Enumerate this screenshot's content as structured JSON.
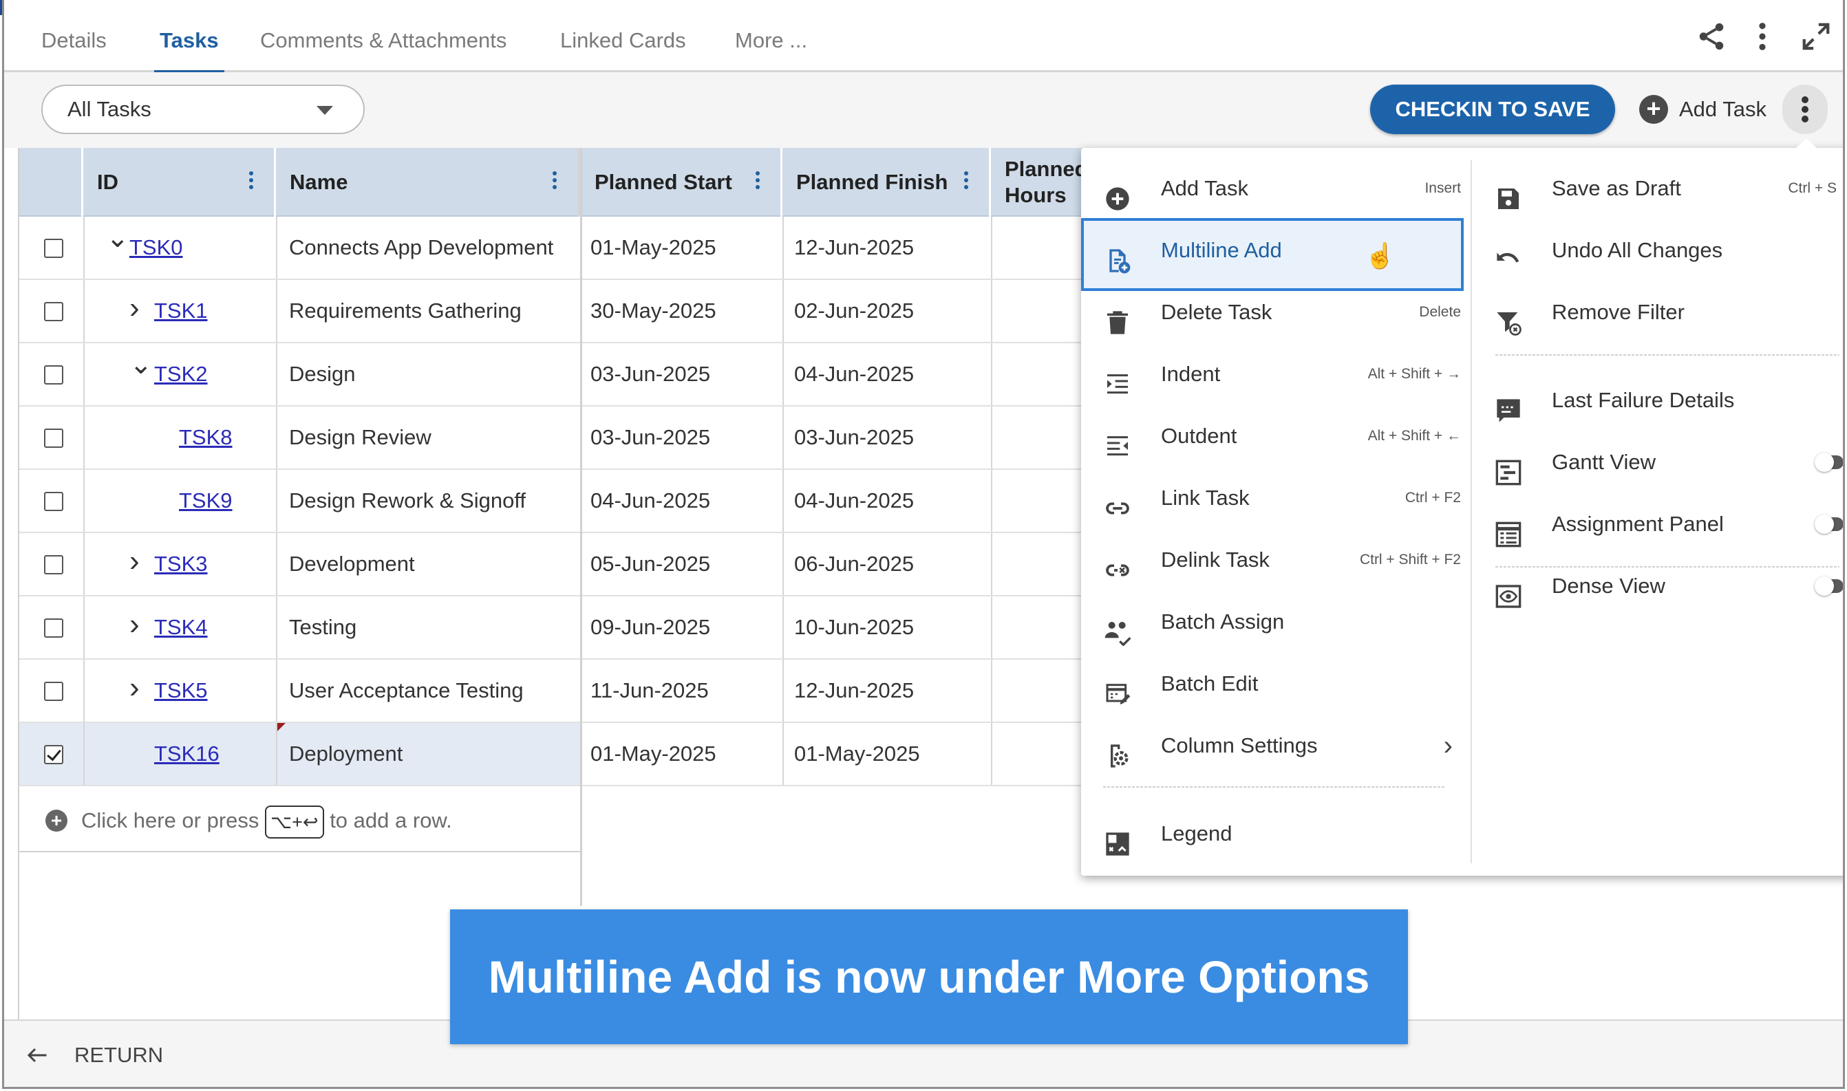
{
  "tabs": [
    "Details",
    "Tasks",
    "Comments & Attachments",
    "Linked Cards",
    "More ..."
  ],
  "active_tab": "Tasks",
  "header_icons": [
    "share-icon",
    "more-vertical-icon",
    "expand-icon"
  ],
  "toolbar": {
    "filter_select": "All Tasks",
    "checkin_button": "CHECKIN TO SAVE",
    "add_task_button": "Add Task"
  },
  "grid": {
    "columns": [
      "ID",
      "Name",
      "Planned Start",
      "Planned Finish",
      "Planned Hours"
    ],
    "rows": [
      {
        "id": "TSK0",
        "name": "Connects App Development",
        "start": "01-May-2025",
        "finish": "12-Jun-2025",
        "expander": "expanded",
        "checked": false
      },
      {
        "id": "TSK1",
        "name": "Requirements Gathering",
        "start": "30-May-2025",
        "finish": "02-Jun-2025",
        "expander": "collapsed",
        "checked": false
      },
      {
        "id": "TSK2",
        "name": "Design",
        "start": "03-Jun-2025",
        "finish": "04-Jun-2025",
        "expander": "expanded",
        "checked": false
      },
      {
        "id": "TSK8",
        "name": "Design Review",
        "start": "03-Jun-2025",
        "finish": "03-Jun-2025",
        "expander": "none",
        "checked": false
      },
      {
        "id": "TSK9",
        "name": "Design Rework & Signoff",
        "start": "04-Jun-2025",
        "finish": "04-Jun-2025",
        "expander": "none",
        "checked": false
      },
      {
        "id": "TSK3",
        "name": "Development",
        "start": "05-Jun-2025",
        "finish": "06-Jun-2025",
        "expander": "collapsed",
        "checked": false
      },
      {
        "id": "TSK4",
        "name": "Testing",
        "start": "09-Jun-2025",
        "finish": "10-Jun-2025",
        "expander": "collapsed",
        "checked": false
      },
      {
        "id": "TSK5",
        "name": "User Acceptance Testing",
        "start": "11-Jun-2025",
        "finish": "12-Jun-2025",
        "expander": "collapsed",
        "checked": false
      },
      {
        "id": "TSK16",
        "name": "Deployment",
        "start": "01-May-2025",
        "finish": "01-May-2025",
        "expander": "none",
        "checked": true
      }
    ],
    "add_row": {
      "before": "Click here or press",
      "keys": "⌥+↩",
      "after": "to add a row."
    }
  },
  "menu": {
    "left": [
      {
        "label": "Add Task",
        "shortcut": "Insert",
        "icon": "plus-circle-icon"
      },
      {
        "label": "Multiline Add",
        "shortcut": "",
        "icon": "file-add-icon",
        "highlighted": true
      },
      {
        "label": "Delete Task",
        "shortcut": "Delete",
        "icon": "trash-icon"
      },
      {
        "label": "Indent",
        "shortcut": "Alt + Shift + →",
        "icon": "indent-icon"
      },
      {
        "label": "Outdent",
        "shortcut": "Alt + Shift + ←",
        "icon": "outdent-icon"
      },
      {
        "label": "Link Task",
        "shortcut": "Ctrl + F2",
        "icon": "link-icon"
      },
      {
        "label": "Delink Task",
        "shortcut": "Ctrl + Shift + F2",
        "icon": "unlink-icon"
      },
      {
        "label": "Batch Assign",
        "shortcut": "",
        "icon": "users-icon"
      },
      {
        "label": "Batch Edit",
        "shortcut": "",
        "icon": "batch-edit-icon"
      },
      {
        "label": "Column Settings",
        "shortcut": "",
        "icon": "column-settings-icon",
        "submenu": true
      },
      {
        "label": "Legend",
        "shortcut": "",
        "icon": "legend-icon"
      }
    ],
    "right": [
      {
        "label": "Save as Draft",
        "shortcut": "Ctrl + S",
        "icon": "save-icon"
      },
      {
        "label": "Undo All Changes",
        "shortcut": "",
        "icon": "undo-icon"
      },
      {
        "label": "Remove Filter",
        "shortcut": "",
        "icon": "filter-remove-icon"
      },
      {
        "label": "Last Failure Details",
        "shortcut": "",
        "icon": "failure-details-icon"
      },
      {
        "label": "Gantt View",
        "shortcut": "",
        "icon": "gantt-icon",
        "toggle": true
      },
      {
        "label": "Assignment Panel",
        "shortcut": "",
        "icon": "assignment-panel-icon",
        "toggle": true
      },
      {
        "label": "Dense View",
        "shortcut": "",
        "icon": "eye-icon",
        "toggle": true
      }
    ]
  },
  "banner": "Multiline Add is now under More Options",
  "footer": {
    "return_label": "RETURN"
  },
  "colors": {
    "accent": "#1e5fa0",
    "button": "#1d63aa",
    "banner": "#3a8ce2",
    "header_bg": "#cfdbe8",
    "link": "#2b2bb8"
  }
}
